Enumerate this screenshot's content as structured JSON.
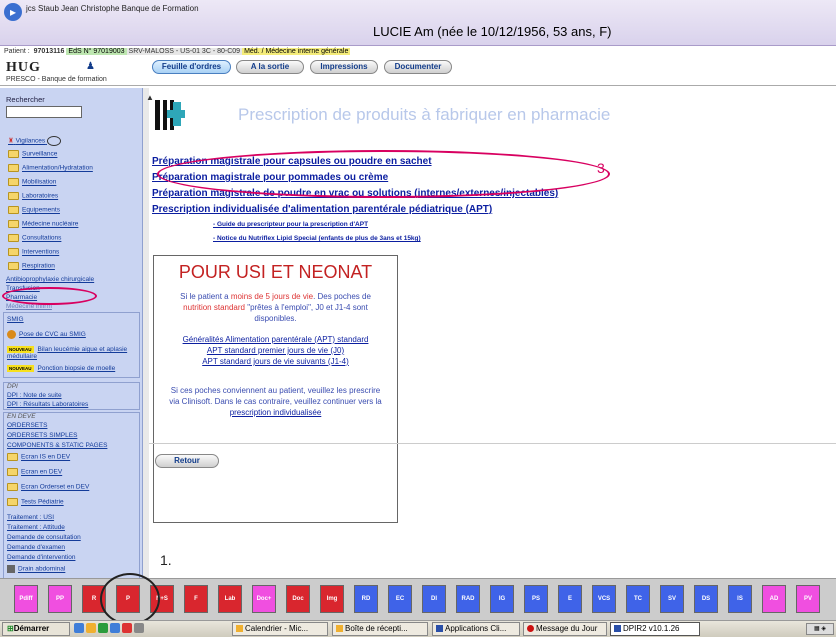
{
  "window": {
    "title": "jcs Staub Jean Christophe Banque de Formation",
    "patient_header": "LUCIE Am (née le 10/12/1956, 53 ans, F)"
  },
  "infobar": {
    "patient_label": "Patient : ",
    "patient_no": "97013116",
    "eds": "EdS N° 97019003",
    "unit": "SRV-MALOSS - US-01 3C - 80-C09",
    "service": "Méd. / Médecine interne générale"
  },
  "toolbar": {
    "logo": "HUG",
    "subtitle": "PRESCO - Banque de formation",
    "tabs": [
      "Feuille d'ordres",
      "A la sortie",
      "Impressions",
      "Documenter"
    ]
  },
  "sidebar": {
    "search_label": "Rechercher",
    "vigilance": "Vigilances",
    "folders": [
      "Surveillance",
      "Alimentation/Hydratation",
      "Mobilisation",
      "Laboratoires",
      "Equipements",
      "Médecine nucléaire",
      "Consultations",
      "Interventions",
      "Respiration"
    ],
    "antibio": "Antibioprophylaxie chirurgicale",
    "transfusion": "Transfusion",
    "pharmacie": "Pharmacie",
    "medecine_infirm": "Médecine infirm",
    "smig": "SMIG",
    "cvc": "Pose de CVC au SMIG",
    "new_label": "NOUVEAU",
    "leucemie": "Bilan leucémie aigue et aplasie médullaire",
    "ponction": "Ponction biopsie de moelle",
    "dpi_section": "DPI",
    "dpi_note": "DPI : Note de suite",
    "dpi_labo": "DPI : Résultats Laboratoires",
    "dev_section": "EN DEVE",
    "ordersets": "ORDERSETS",
    "ordersets_simples": "ORDERSETS SIMPLES",
    "components": "COMPONENTS & STATIC PAGES",
    "dev_folders": [
      "Ecran IS en DEV",
      "Ecran en DEV",
      "Ecran Orderset en DEV",
      "Tests Pédiatrie"
    ],
    "traitement_usi": "Traitement : USI",
    "traitement_attitude": "Traitement : Attitude",
    "demande_consult": "Demande de consultation",
    "demande_examen": "Demande d'examen",
    "demande_intervention": "Demande d'intervention",
    "drain": "Drain abdominal"
  },
  "main": {
    "heading": "Prescription de produits à fabriquer en pharmacie",
    "links": [
      "Préparation magistrale pour capsules ou poudre en sachet",
      "Préparation magistrale pour pommades ou crème",
      "Préparation magistrale de poudre en vrac ou solutions (internes/externes/injectables)",
      "Prescription individualisée d'alimentation parentérale pédiatrique (APT)"
    ],
    "apt_guide": "- Guide du prescripteur pour la prescription d'APT",
    "apt_notice": "- Notice du Nutriflex Lipid Special (enfants de plus de 3ans et 15kg)",
    "usi_title": "POUR USI ET NEONAT",
    "usi_p1_a": "Si le patient a ",
    "usi_p1_red1": "moins de 5 jours de vie",
    "usi_p1_b": ". Des poches de ",
    "usi_p1_red2": "nutrition standard",
    "usi_p1_c": " \"prêtes à l'emploi\", J0 et J1-4 sont disponibles.",
    "usi_link1": "Généralités Alimentation parentérale (APT) standard",
    "usi_link2": "APT standard premier jours de vie (J0)",
    "usi_link3": "APT standard jours de vie suivants (J1-4)",
    "usi_p2": "Si ces poches conviennent au patient, veuillez les prescrire via Clinisoft. Dans le cas contraire, veuillez continuer vers la ",
    "usi_p2_link": "prescription individualisée",
    "retour": "Retour"
  },
  "annotations": {
    "n1": "1.",
    "n3": "3"
  },
  "appbar": {
    "buttons": [
      {
        "label": "Pdiff",
        "color": "pink"
      },
      {
        "label": "PP",
        "color": "pink"
      },
      {
        "label": "R",
        "color": "red"
      },
      {
        "label": "P",
        "color": "red"
      },
      {
        "label": "N+S",
        "color": "red"
      },
      {
        "label": "F",
        "color": "red"
      },
      {
        "label": "Lab",
        "color": "red"
      },
      {
        "label": "Doc+",
        "color": "pink"
      },
      {
        "label": "Doc",
        "color": "red"
      },
      {
        "label": "Img",
        "color": "red"
      },
      {
        "label": "RD",
        "color": "blue"
      },
      {
        "label": "EC",
        "color": "blue"
      },
      {
        "label": "DI",
        "color": "blue"
      },
      {
        "label": "RAD",
        "color": "blue"
      },
      {
        "label": "IG",
        "color": "blue"
      },
      {
        "label": "PS",
        "color": "blue"
      },
      {
        "label": "E",
        "color": "blue"
      },
      {
        "label": "VCS",
        "color": "blue"
      },
      {
        "label": "TC",
        "color": "blue"
      },
      {
        "label": "SV",
        "color": "blue"
      },
      {
        "label": "DS",
        "color": "blue"
      },
      {
        "label": "IS",
        "color": "blue"
      },
      {
        "label": "AD",
        "color": "pink"
      },
      {
        "label": "PV",
        "color": "pink"
      }
    ]
  },
  "taskbar": {
    "start": "Démarrer",
    "tasks": [
      "Calendrier - Mic...",
      "Boîte de récepti...",
      "Applications Cli...",
      "Message du Jour",
      "DPIR2 v10.1.26"
    ]
  }
}
